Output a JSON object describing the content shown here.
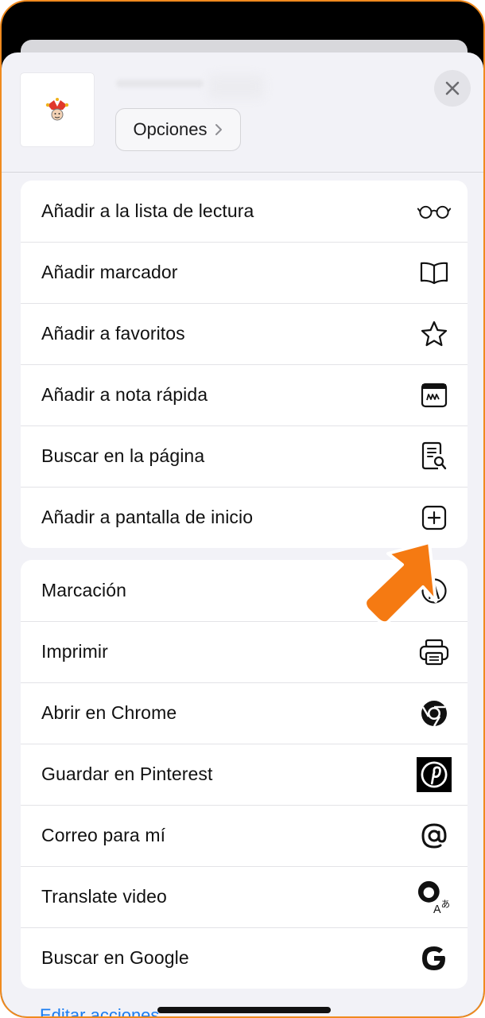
{
  "header": {
    "options_label": "Opciones"
  },
  "group1": [
    {
      "label": "Añadir a la lista de lectura",
      "icon": "glasses-icon"
    },
    {
      "label": "Añadir marcador",
      "icon": "book-icon"
    },
    {
      "label": "Añadir a favoritos",
      "icon": "star-icon"
    },
    {
      "label": "Añadir a nota rápida",
      "icon": "quick-note-icon"
    },
    {
      "label": "Buscar en la página",
      "icon": "find-on-page-icon"
    },
    {
      "label": "Añadir a pantalla de inicio",
      "icon": "add-square-icon"
    }
  ],
  "group2": [
    {
      "label": "Marcación",
      "icon": "markup-pen-icon"
    },
    {
      "label": "Imprimir",
      "icon": "printer-icon"
    },
    {
      "label": "Abrir en Chrome",
      "icon": "chrome-icon"
    },
    {
      "label": "Guardar en Pinterest",
      "icon": "pinterest-icon"
    },
    {
      "label": "Correo para mí",
      "icon": "at-sign-icon"
    },
    {
      "label": "Translate video",
      "icon": "translate-icon"
    },
    {
      "label": "Buscar en Google",
      "icon": "google-icon"
    }
  ],
  "footer": {
    "edit_actions": "Editar acciones..."
  },
  "colors": {
    "accent_orange": "#f08a1e",
    "link_blue": "#1a7cf0"
  }
}
